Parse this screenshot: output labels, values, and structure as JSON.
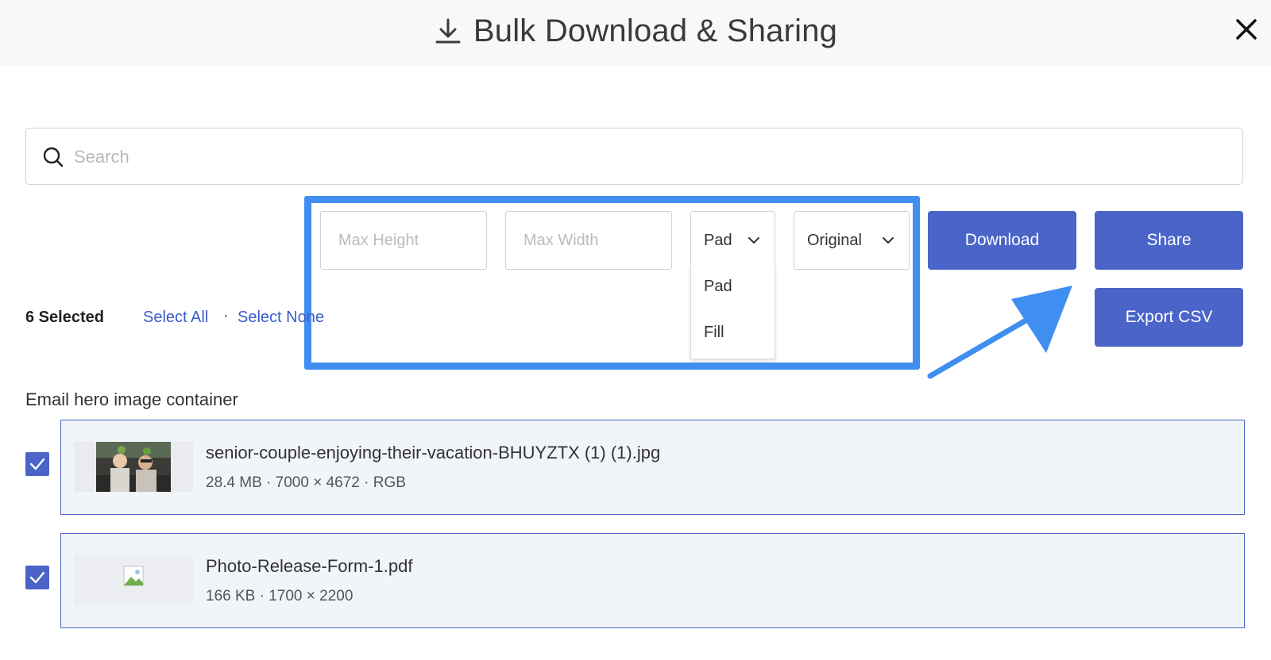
{
  "header": {
    "title": "Bulk Download & Sharing",
    "download_icon": "download-icon",
    "close_icon": "close-icon"
  },
  "search": {
    "placeholder": "Search",
    "value": "",
    "icon": "search-icon"
  },
  "options": {
    "max_height_placeholder": "Max Height",
    "max_width_placeholder": "Max Width",
    "mode_selected": "Pad",
    "mode_options": [
      "Pad",
      "Fill"
    ],
    "format_selected": "Original"
  },
  "actions": {
    "download_label": "Download",
    "share_label": "Share",
    "export_csv_label": "Export CSV"
  },
  "selection": {
    "count_label": "6 Selected",
    "select_all_label": "Select All",
    "separator": "·",
    "select_none_label": "Select None"
  },
  "group": {
    "title": "Email hero image container",
    "files": [
      {
        "name": "senior-couple-enjoying-their-vacation-BHUYZTX (1) (1).jpg",
        "meta": "28.4 MB · 7000 × 4672 · RGB",
        "checked": true
      },
      {
        "name": "Photo-Release-Form-1.pdf",
        "meta": "166 KB · 1700 × 2200",
        "checked": true
      }
    ]
  },
  "colors": {
    "primary": "#4a64c8",
    "highlight": "#3f8ef0",
    "link": "#3a5cc8",
    "header_bg": "#f8f8f9",
    "row_bg": "#f1f4f9"
  }
}
